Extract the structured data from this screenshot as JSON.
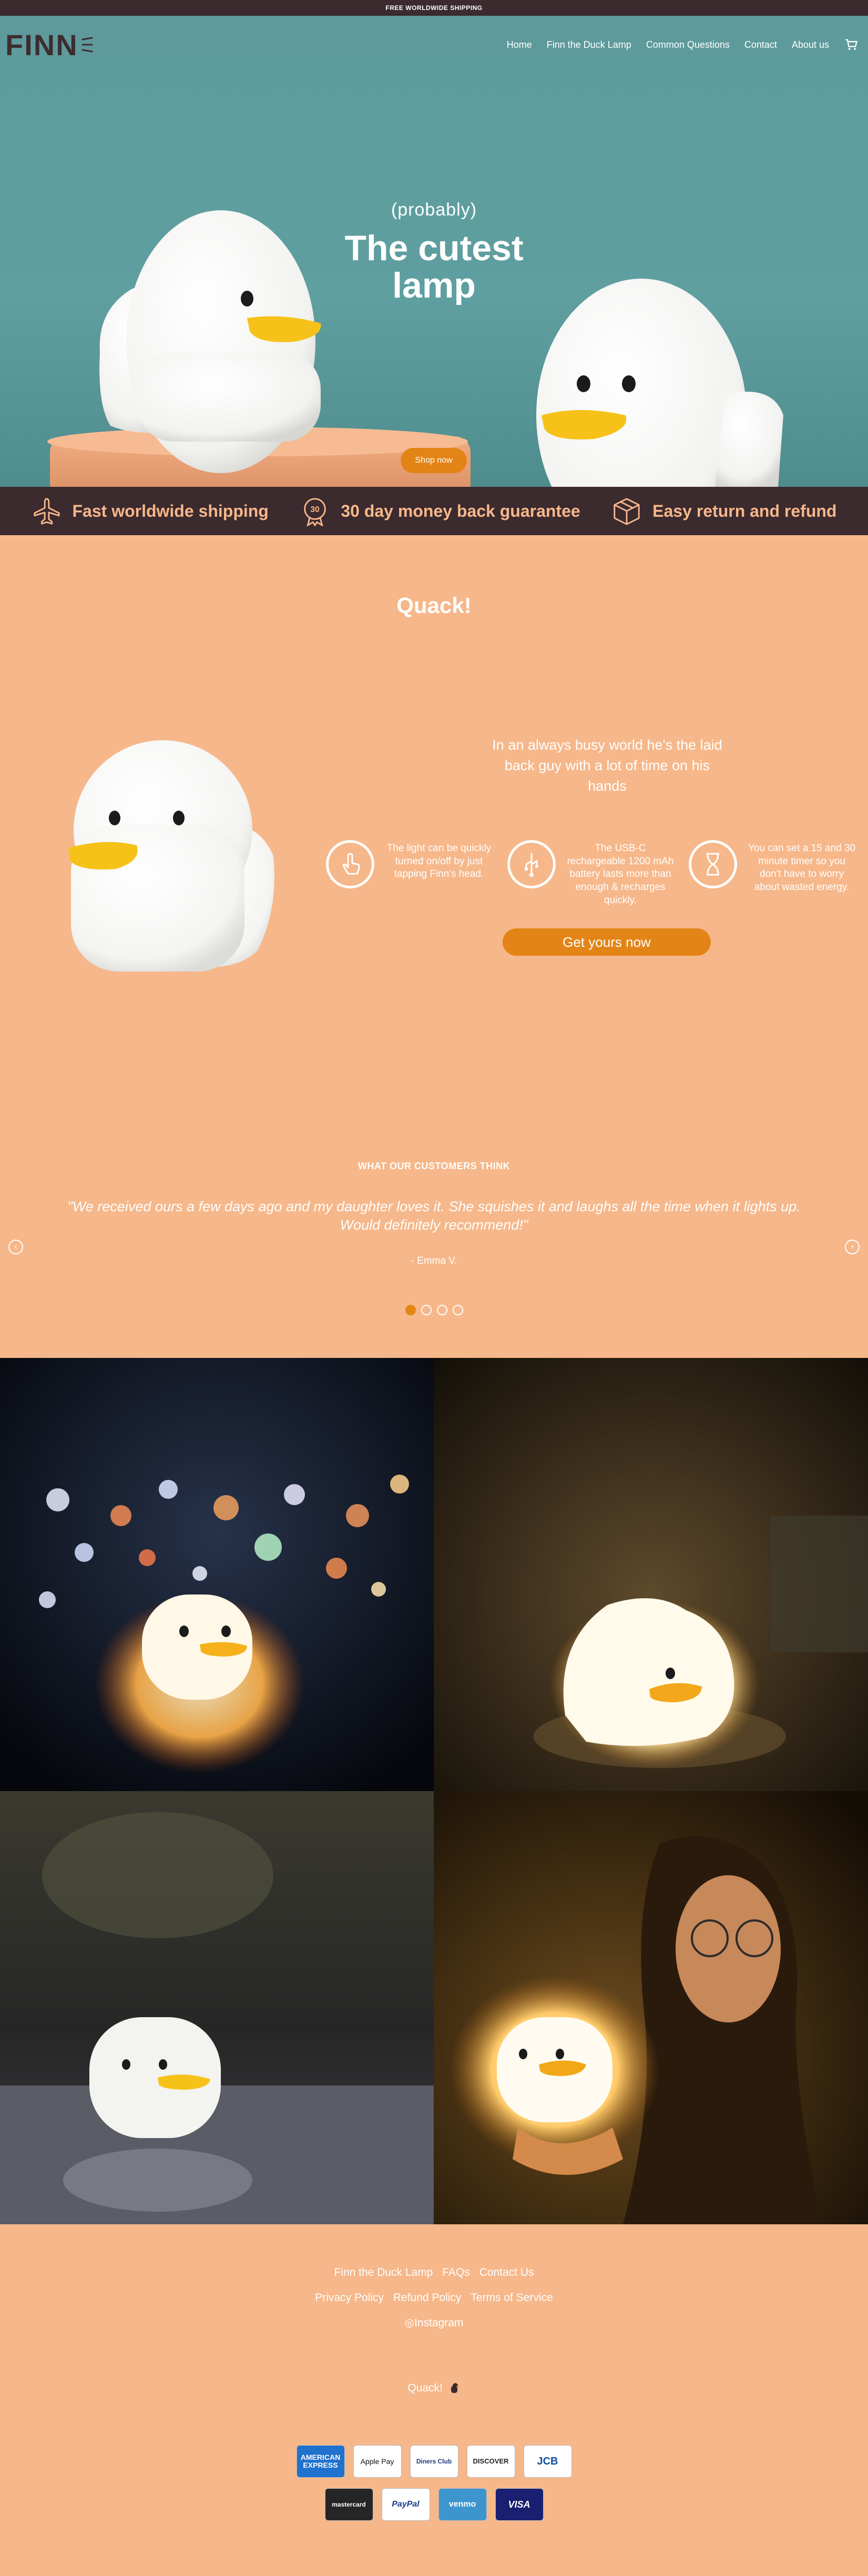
{
  "announcement": {
    "text": "FREE WORLDWIDE SHIPPING"
  },
  "header": {
    "logo": "FINN",
    "nav": [
      {
        "label": "Home"
      },
      {
        "label": "Finn the Duck Lamp"
      },
      {
        "label": "Common Questions"
      },
      {
        "label": "Contact"
      },
      {
        "label": "About us"
      }
    ],
    "cart_icon": "cart-icon"
  },
  "hero": {
    "subtitle": "(probably)",
    "title_line1": "The cutest",
    "title_line2": "lamp",
    "button": "Shop now"
  },
  "trust": [
    {
      "icon": "airplane-icon",
      "label": "Fast worldwide shipping"
    },
    {
      "icon": "thirty-day-badge-icon",
      "label": "30 day money back guarantee",
      "badge": "30"
    },
    {
      "icon": "box-icon",
      "label": "Easy return and refund"
    }
  ],
  "product": {
    "heading": "Quack!",
    "tagline": "In an always busy world he's the laid back guy with a lot of time on his hands",
    "features": [
      {
        "icon": "tap-icon",
        "text": "The light can be quickly turned on/off by just tapping Finn's head."
      },
      {
        "icon": "usb-icon",
        "text": "The USB-C rechargeable 1200 mAh battery lasts more than enough & recharges quickly."
      },
      {
        "icon": "hourglass-icon",
        "text": "You can set a 15 and 30 minute timer so you don't have to worry about wasted energy."
      }
    ],
    "cta": "Get yours now"
  },
  "reviews": {
    "heading": "WHAT OUR CUSTOMERS THINK",
    "quote": "\"We received ours a few days ago and my daughter loves it. She squishes it and laughs all the time when it lights up. Would definitely recommend!\"",
    "author": "- Emma V.",
    "slides": 4,
    "active": 1
  },
  "footer": {
    "links_row1": [
      "Finn the Duck Lamp",
      "FAQs",
      "Contact Us"
    ],
    "links_row2": [
      "Privacy Policy",
      "Refund Policy",
      "Terms of Service"
    ],
    "instagram": "Instagram",
    "quack": "Quack!",
    "payments_row1": [
      "AMERICAN EXPRESS",
      "Apple Pay",
      "Diners Club",
      "DISCOVER",
      "JCB"
    ],
    "payments_row2": [
      "mastercard",
      "PayPal",
      "venmo",
      "VISA"
    ]
  },
  "colors": {
    "peach": "#f6b78a",
    "dark": "#3b2a2e",
    "orange": "#e38516",
    "teal": "#5f9fa0"
  }
}
